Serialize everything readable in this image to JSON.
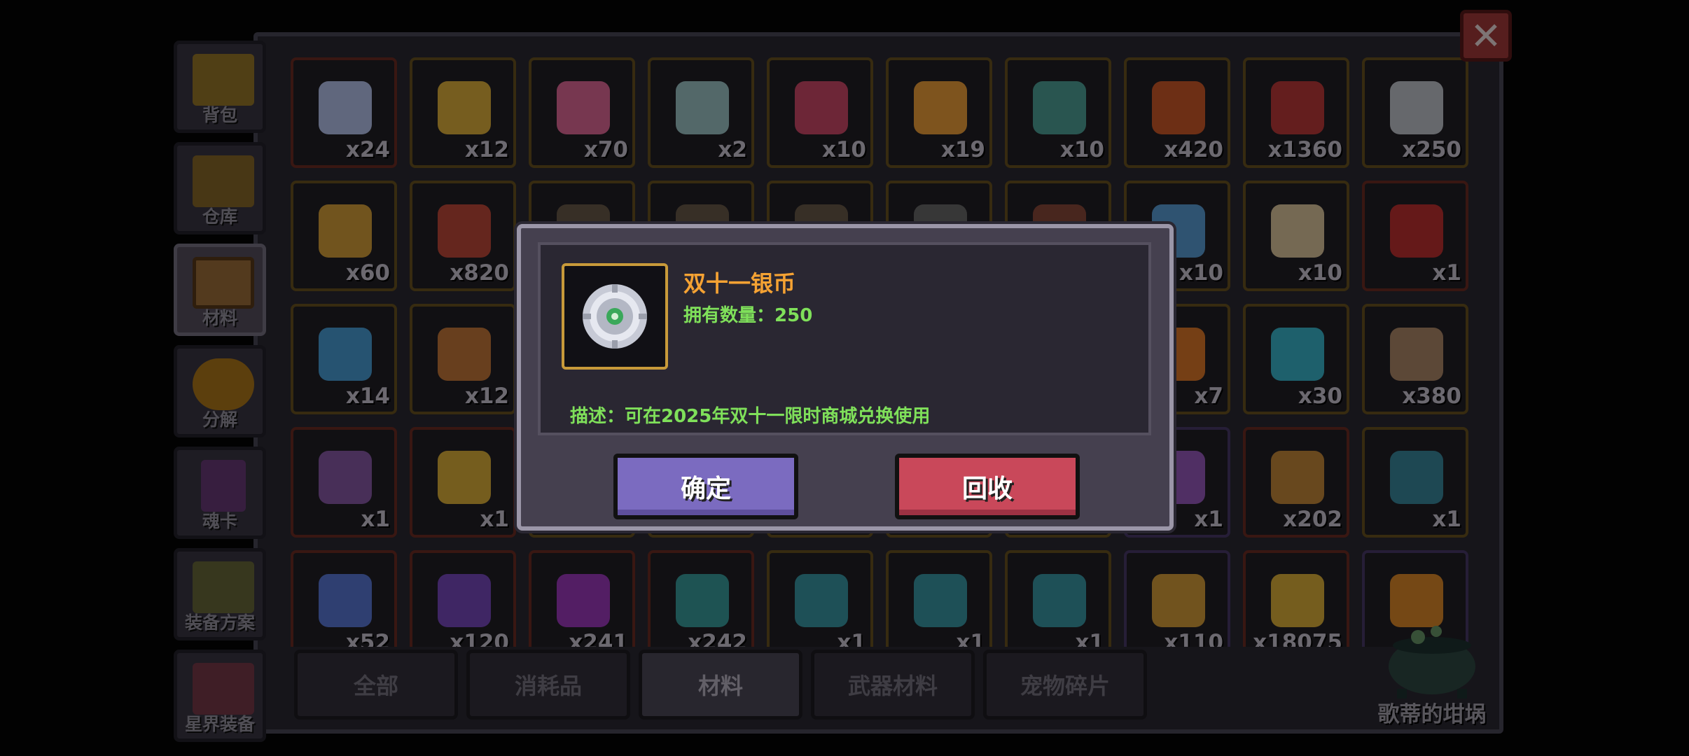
{
  "sidebar": {
    "items": [
      {
        "label": "背包",
        "icon": "chest-icon"
      },
      {
        "label": "仓库",
        "icon": "warehouse-chest-icon"
      },
      {
        "label": "材料",
        "icon": "material-box-icon"
      },
      {
        "label": "分解",
        "icon": "disassemble-icon"
      },
      {
        "label": "魂卡",
        "icon": "soul-card-icon"
      },
      {
        "label": "装备方案",
        "icon": "equipment-plan-icon"
      },
      {
        "label": "星界装备",
        "icon": "astral-equipment-icon"
      }
    ],
    "active_index": 2
  },
  "grid": {
    "items": [
      {
        "count": "x24",
        "icon": "crystal-star-icon",
        "color": "#b9c6f0",
        "rarity": "red"
      },
      {
        "count": "x12",
        "icon": "gold-coin-icon",
        "color": "#e3b23c",
        "rarity": "gold"
      },
      {
        "count": "x70",
        "icon": "lollipop-icon",
        "color": "#e56a9a",
        "rarity": "gold"
      },
      {
        "count": "x2",
        "icon": "pearl-shell-icon",
        "color": "#9fc7c9",
        "rarity": "gold"
      },
      {
        "count": "x10",
        "icon": "masquerade-mask-icon",
        "color": "#d24a6a",
        "rarity": "gold"
      },
      {
        "count": "x19",
        "icon": "sun-moon-icon",
        "color": "#f2a23a",
        "rarity": "gold"
      },
      {
        "count": "x10",
        "icon": "gargoyle-statue-icon",
        "color": "#4fa39a",
        "rarity": "gold"
      },
      {
        "count": "x420",
        "icon": "banner-flag-icon",
        "color": "#d25a2a",
        "rarity": "gold"
      },
      {
        "count": "x1360",
        "icon": "yarn-ball-icon",
        "color": "#c03a3a",
        "rarity": "gold"
      },
      {
        "count": "x250",
        "icon": "silver-coin-icon",
        "color": "#c4c7cf",
        "rarity": "gold"
      },
      {
        "count": "x60",
        "icon": "gold-medallion-icon",
        "color": "#d8a23a",
        "rarity": "gold"
      },
      {
        "count": "x820",
        "icon": "boot-icon",
        "color": "#c24a3a",
        "rarity": "gold"
      },
      {
        "count": "",
        "icon": "item-icon",
        "color": "#6a5a4a",
        "rarity": "gold"
      },
      {
        "count": "",
        "icon": "item-icon",
        "color": "#6a5a4a",
        "rarity": "gold"
      },
      {
        "count": "",
        "icon": "item-icon",
        "color": "#6a5a4a",
        "rarity": "gold"
      },
      {
        "count": "",
        "icon": "item-icon",
        "color": "#6a6a6a",
        "rarity": "gold"
      },
      {
        "count": "",
        "icon": "item-icon",
        "color": "#8a4a3a",
        "rarity": "gold"
      },
      {
        "count": "x10",
        "icon": "blue-orb-icon",
        "color": "#5aa0d8",
        "rarity": "gold"
      },
      {
        "count": "x10",
        "icon": "scroll-icon",
        "color": "#e0c9a0",
        "rarity": "gold"
      },
      {
        "count": "x1",
        "icon": "fuel-can-icon",
        "color": "#c23030",
        "rarity": "red"
      },
      {
        "count": "x14",
        "icon": "map-icon",
        "color": "#4aa0d8",
        "rarity": "gold"
      },
      {
        "count": "x12",
        "icon": "drum-icon",
        "color": "#c87a3a",
        "rarity": "gold"
      },
      {
        "count": "",
        "icon": "item-icon",
        "color": "#3a3a3a",
        "rarity": "gold"
      },
      {
        "count": "",
        "icon": "item-icon",
        "color": "#3a3a3a",
        "rarity": "gold"
      },
      {
        "count": "",
        "icon": "item-icon",
        "color": "#3a3a3a",
        "rarity": "gold"
      },
      {
        "count": "",
        "icon": "item-icon",
        "color": "#3a3a3a",
        "rarity": "gold"
      },
      {
        "count": "",
        "icon": "item-icon",
        "color": "#3a3a3a",
        "rarity": "gold"
      },
      {
        "count": "x7",
        "icon": "flame-creature-icon",
        "color": "#e07a2a",
        "rarity": "gold"
      },
      {
        "count": "x30",
        "icon": "blue-slime-icon",
        "color": "#3ab8d0",
        "rarity": "gold"
      },
      {
        "count": "x380",
        "icon": "bat-wing-icon",
        "color": "#b08a6a",
        "rarity": "gold"
      },
      {
        "count": "x1",
        "icon": "purple-gem-icon",
        "color": "#8a5aaa",
        "rarity": "red"
      },
      {
        "count": "x1",
        "icon": "gold-key-icon",
        "color": "#e0b23a",
        "rarity": "red"
      },
      {
        "count": "",
        "icon": "item-icon",
        "color": "#3a3a3a",
        "rarity": "gold"
      },
      {
        "count": "",
        "icon": "item-icon",
        "color": "#3a3a3a",
        "rarity": "gold"
      },
      {
        "count": "",
        "icon": "item-icon",
        "color": "#3a3a3a",
        "rarity": "gold"
      },
      {
        "count": "",
        "icon": "item-icon",
        "color": "#3a3a3a",
        "rarity": "gold"
      },
      {
        "count": "",
        "icon": "item-icon",
        "color": "#3a3a3a",
        "rarity": "gold"
      },
      {
        "count": "x1",
        "icon": "potion-icon",
        "color": "#9a5ac0",
        "rarity": "purple"
      },
      {
        "count": "x202",
        "icon": "warrior-figure-icon",
        "color": "#c88a3a",
        "rarity": "red"
      },
      {
        "count": "x1",
        "icon": "stone-tablet-icon",
        "color": "#3a8aa0",
        "rarity": "gold"
      },
      {
        "count": "x52",
        "icon": "blue-chain-icon",
        "color": "#5a7ad8",
        "rarity": "red"
      },
      {
        "count": "x120",
        "icon": "dark-crystal-icon",
        "color": "#7a4ac0",
        "rarity": "red"
      },
      {
        "count": "x241",
        "icon": "purple-flower-icon",
        "color": "#a03ac0",
        "rarity": "red"
      },
      {
        "count": "x242",
        "icon": "teal-sword-icon",
        "color": "#3aa0a0",
        "rarity": "red"
      },
      {
        "count": "x1",
        "icon": "rune-tablet-icon",
        "color": "#3a9aa8",
        "rarity": "gold"
      },
      {
        "count": "x1",
        "icon": "rune-tablet-icon",
        "color": "#3a9aa8",
        "rarity": "gold"
      },
      {
        "count": "x1",
        "icon": "rune-tablet-icon",
        "color": "#3a9aa8",
        "rarity": "gold"
      },
      {
        "count": "x110",
        "icon": "lightning-orb-icon",
        "color": "#d8a03a",
        "rarity": "purple"
      },
      {
        "count": "x18075",
        "icon": "gold-crown-badge-icon",
        "color": "#e0b23a",
        "rarity": "red"
      },
      {
        "count": "",
        "icon": "fire-burst-icon",
        "color": "#e08a2a",
        "rarity": "purple"
      }
    ]
  },
  "tabs": [
    {
      "label": "全部"
    },
    {
      "label": "消耗品"
    },
    {
      "label": "材料"
    },
    {
      "label": "武器材料"
    },
    {
      "label": "宠物碎片"
    }
  ],
  "active_tab": 2,
  "shop": {
    "label": "歌蒂的坩埚",
    "icon": "cauldron-icon"
  },
  "close_button": {
    "label": "✕"
  },
  "modal": {
    "item_name": "双十一银币",
    "qty_label": "拥有数量：",
    "qty_value": "250",
    "description": "描述：可在2025年双十一限时商城兑换使用",
    "confirm_label": "确定",
    "recycle_label": "回收",
    "icon": "silver-coin-icon"
  },
  "colors": {
    "title_orange": "#f5a233",
    "text_green": "#7fe05a",
    "confirm_purple": "#7b6bc0",
    "recycle_red": "#c9485a"
  }
}
